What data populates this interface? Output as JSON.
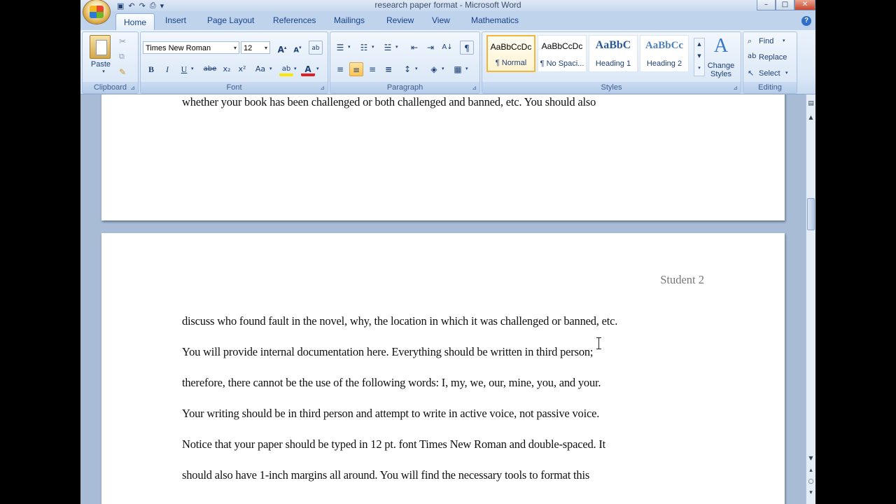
{
  "window": {
    "title": "research paper format - Microsoft Word",
    "controls": [
      "–",
      "□",
      "✕"
    ]
  },
  "quick_access": [
    "save-icon",
    "undo-icon",
    "redo-icon",
    "print-preview-icon",
    "customize-icon"
  ],
  "tabs": [
    {
      "label": "Home",
      "active": true
    },
    {
      "label": "Insert"
    },
    {
      "label": "Page Layout"
    },
    {
      "label": "References"
    },
    {
      "label": "Mailings"
    },
    {
      "label": "Review"
    },
    {
      "label": "View"
    },
    {
      "label": "Mathematics"
    }
  ],
  "ribbon": {
    "clipboard": {
      "label": "Clipboard",
      "paste": "Paste"
    },
    "font": {
      "label": "Font",
      "family": "Times New Roman",
      "size": "12",
      "buttons": [
        "B",
        "I",
        "U",
        "abe",
        "x₂",
        "x²",
        "Aa"
      ]
    },
    "paragraph": {
      "label": "Paragraph"
    },
    "styles": {
      "label": "Styles",
      "items": [
        {
          "sample": "AaBbCcDc",
          "name": "¶ Normal",
          "selected": true
        },
        {
          "sample": "AaBbCcDc",
          "name": "¶ No Spaci..."
        },
        {
          "sample": "AaBbC",
          "name": "Heading 1"
        },
        {
          "sample": "AaBbCc",
          "name": "Heading 2"
        }
      ],
      "change_styles": "Change Styles"
    },
    "editing": {
      "label": "Editing",
      "find": "Find",
      "replace": "Replace",
      "select": "Select"
    }
  },
  "document": {
    "page1_last_line": "whether your book has been challenged or both challenged and banned, etc.  You should also",
    "page2_header": "Student 2",
    "page2_lines": [
      "discuss who found fault in the novel, why, the location in which it was challenged or banned, etc.",
      "You will provide internal documentation here. Everything should be written in third person;",
      "therefore, there cannot be the use of the following words: I, my, we, our, mine, you, and your.",
      "Your writing should be in third person and attempt to write in active voice, not passive voice.",
      "Notice that your paper should be typed in 12 pt. font Times New Roman and double-spaced.  It",
      "should also have 1-inch margins all around.  You will find the necessary tools to format this"
    ]
  }
}
